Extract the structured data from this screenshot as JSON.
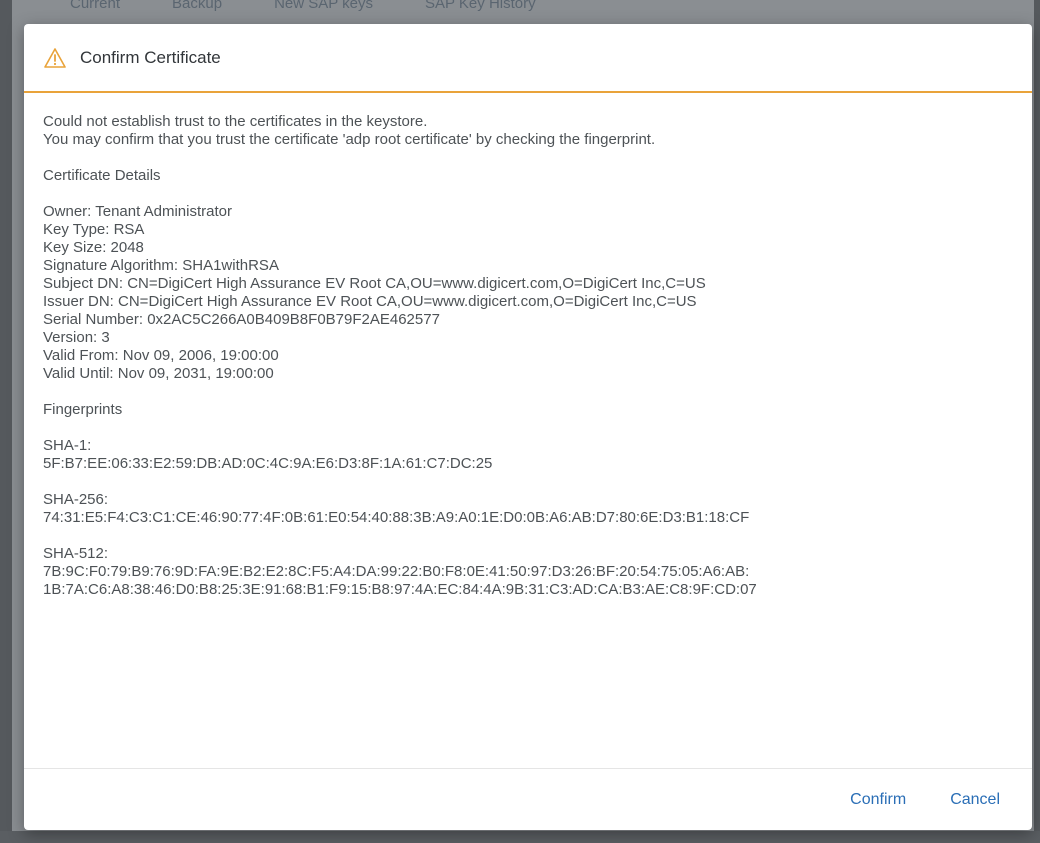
{
  "background": {
    "tabs": [
      "Current",
      "Backup",
      "New SAP keys",
      "SAP Key History"
    ]
  },
  "dialog": {
    "title": "Confirm Certificate",
    "icon": "warning-icon",
    "accent_color": "#e9a33a",
    "message_line1": "Could not establish trust to the certificates in the keystore.",
    "message_line2": "You may confirm that you trust the certificate 'adp root certificate' by checking the fingerprint.",
    "details_heading": "Certificate Details",
    "details": [
      "Owner: Tenant Administrator",
      "Key Type: RSA",
      "Key Size: 2048",
      "Signature Algorithm: SHA1withRSA",
      "Subject DN: CN=DigiCert High Assurance EV Root CA,OU=www.digicert.com,O=DigiCert Inc,C=US",
      "Issuer DN: CN=DigiCert High Assurance EV Root CA,OU=www.digicert.com,O=DigiCert Inc,C=US",
      "Serial Number: 0x2AC5C266A0B409B8F0B79F2AE462577",
      "Version: 3",
      "Valid From: Nov 09, 2006, 19:00:00",
      "Valid Until: Nov 09, 2031, 19:00:00"
    ],
    "fingerprints_heading": "Fingerprints",
    "sha1_label": "SHA-1:",
    "sha1_value": "5F:B7:EE:06:33:E2:59:DB:AD:0C:4C:9A:E6:D3:8F:1A:61:C7:DC:25",
    "sha256_label": "SHA-256:",
    "sha256_value": "74:31:E5:F4:C3:C1:CE:46:90:77:4F:0B:61:E0:54:40:88:3B:A9:A0:1E:D0:0B:A6:AB:D7:80:6E:D3:B1:18:CF",
    "sha512_label": "SHA-512:",
    "sha512_value_line1": "7B:9C:F0:79:B9:76:9D:FA:9E:B2:E2:8C:F5:A4:DA:99:22:B0:F8:0E:41:50:97:D3:26:BF:20:54:75:05:A6:AB:",
    "sha512_value_line2": "1B:7A:C6:A8:38:46:D0:B8:25:3E:91:68:B1:F9:15:B8:97:4A:EC:84:4A:9B:31:C3:AD:CA:B3:AE:C8:9F:CD:07",
    "confirm_label": "Confirm",
    "cancel_label": "Cancel",
    "button_color": "#2a6eb6"
  }
}
